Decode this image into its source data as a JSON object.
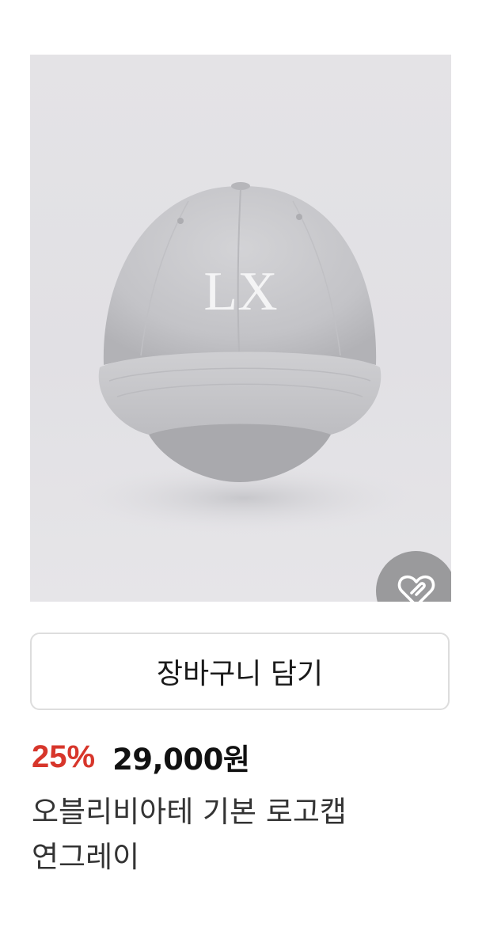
{
  "product": {
    "image_alt": "오블리비아테 기본 로고캡 연그레이",
    "logo_text": "LX",
    "wish_icon": "heart-icon",
    "cart_button_label": "장바구니 담기",
    "discount": "25%",
    "price": "29,000원",
    "name": "오블리비아테 기본 로고캡 연그레이"
  },
  "colors": {
    "discount": "#d7362b",
    "wish_button_bg": "#9a9a9c",
    "image_bg": "#e2e1e5"
  }
}
